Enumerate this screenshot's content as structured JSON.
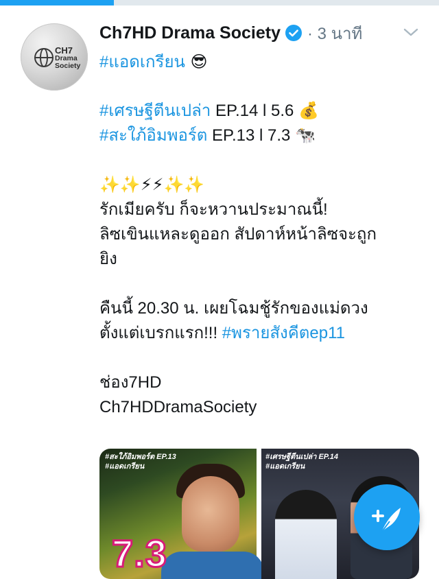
{
  "tweet": {
    "author_name": "Ch7HD Drama Society",
    "time": "3 นาที",
    "separator": "·",
    "avatar_logo": {
      "line1": "CH7",
      "line2": "Drama",
      "line3": "Society"
    },
    "lines": [
      {
        "type": "tag",
        "text": "#แอดเกรียน",
        "suffix": " 😎"
      },
      {
        "type": "gap"
      },
      {
        "type": "mixed",
        "tag": "#เศรษฐีตีนเปล่า",
        "text": "  EP.14 l 5.6 💰"
      },
      {
        "type": "mixed",
        "tag": "#สะใภ้อิมพอร์ต",
        "text": "  EP.13 l 7.3 🐄"
      },
      {
        "type": "gap"
      },
      {
        "type": "text",
        "text": "✨✨⚡⚡✨✨"
      },
      {
        "type": "text",
        "text": "รักเมียครับ ก็จะหวานประมาณนี้!"
      },
      {
        "type": "text",
        "text": "ลิซเขินแหละดูออก สัปดาห์หน้าลิซจะถูก"
      },
      {
        "type": "text",
        "text": "ยิง"
      },
      {
        "type": "gap"
      },
      {
        "type": "text",
        "text": "คืนนี้ 20.30 น. เผยโฉมชู้รักของแม่ดวง"
      },
      {
        "type": "mixed",
        "text": "ตั้งแต่เบรกแรก!!! ",
        "tag": "#พรายสังคีตep11",
        "tag_after": true
      },
      {
        "type": "gap"
      },
      {
        "type": "text",
        "text": "ช่อง7HD"
      },
      {
        "type": "text",
        "text": "Ch7HDDramaSociety"
      }
    ],
    "media": [
      {
        "caption_line1": "#สะใภ้อิมพอร์ต EP.13",
        "caption_line2": "#แอดเกรียน",
        "overlay_text": "7.3"
      },
      {
        "caption_line1": "#เศรษฐีตีนเปล่า EP.14",
        "caption_line2": "#แอดเกรียน"
      }
    ]
  },
  "icons": {
    "verified": "verified-badge-icon",
    "menu": "chevron-down-icon",
    "compose": "compose-tweet-icon"
  },
  "colors": {
    "accent": "#1da1f2",
    "link": "#1b95e0",
    "muted": "#657786",
    "text": "#14171a"
  }
}
